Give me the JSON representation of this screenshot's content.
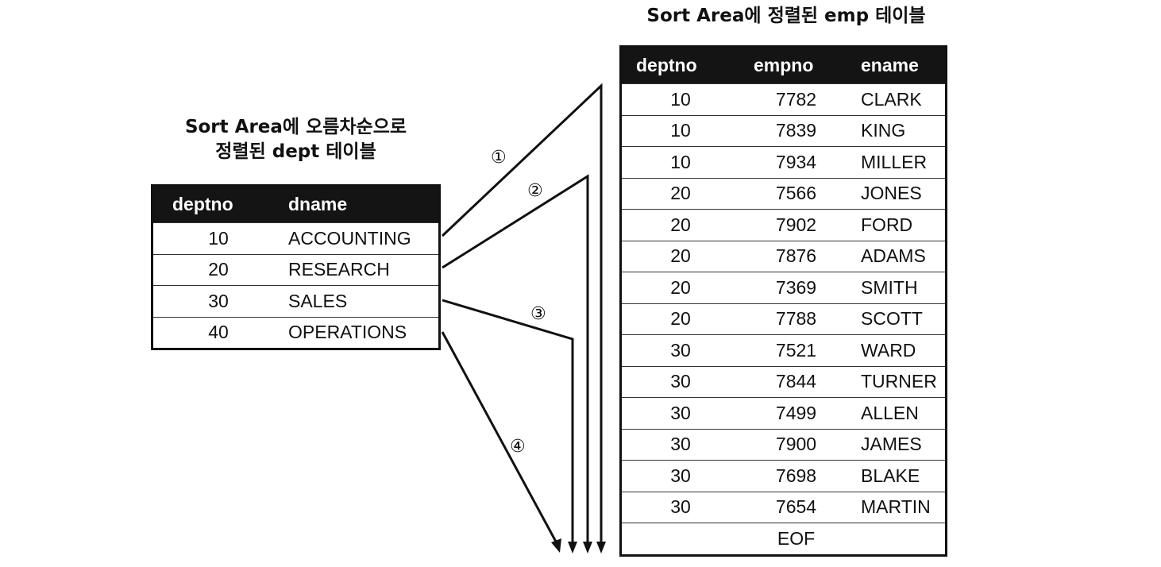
{
  "dept": {
    "title_line1": "Sort Area에 오름차순으로",
    "title_line2": "정렬된 dept 테이블",
    "columns": [
      "deptno",
      "dname"
    ],
    "rows": [
      [
        "10",
        "ACCOUNTING"
      ],
      [
        "20",
        "RESEARCH"
      ],
      [
        "30",
        "SALES"
      ],
      [
        "40",
        "OPERATIONS"
      ]
    ]
  },
  "emp": {
    "title": "Sort Area에 정렬된 emp 테이블",
    "columns": [
      "deptno",
      "empno",
      "ename"
    ],
    "rows": [
      [
        "10",
        "7782",
        "CLARK"
      ],
      [
        "10",
        "7839",
        "KING"
      ],
      [
        "10",
        "7934",
        "MILLER"
      ],
      [
        "20",
        "7566",
        "JONES"
      ],
      [
        "20",
        "7902",
        "FORD"
      ],
      [
        "20",
        "7876",
        "ADAMS"
      ],
      [
        "20",
        "7369",
        "SMITH"
      ],
      [
        "20",
        "7788",
        "SCOTT"
      ],
      [
        "30",
        "7521",
        "WARD"
      ],
      [
        "30",
        "7844",
        "TURNER"
      ],
      [
        "30",
        "7499",
        "ALLEN"
      ],
      [
        "30",
        "7900",
        "JAMES"
      ],
      [
        "30",
        "7698",
        "BLAKE"
      ],
      [
        "30",
        "7654",
        "MARTIN"
      ]
    ],
    "eof_label": "EOF"
  },
  "arrows": {
    "markers": [
      "①",
      "②",
      "③",
      "④"
    ],
    "color": "#111111"
  }
}
